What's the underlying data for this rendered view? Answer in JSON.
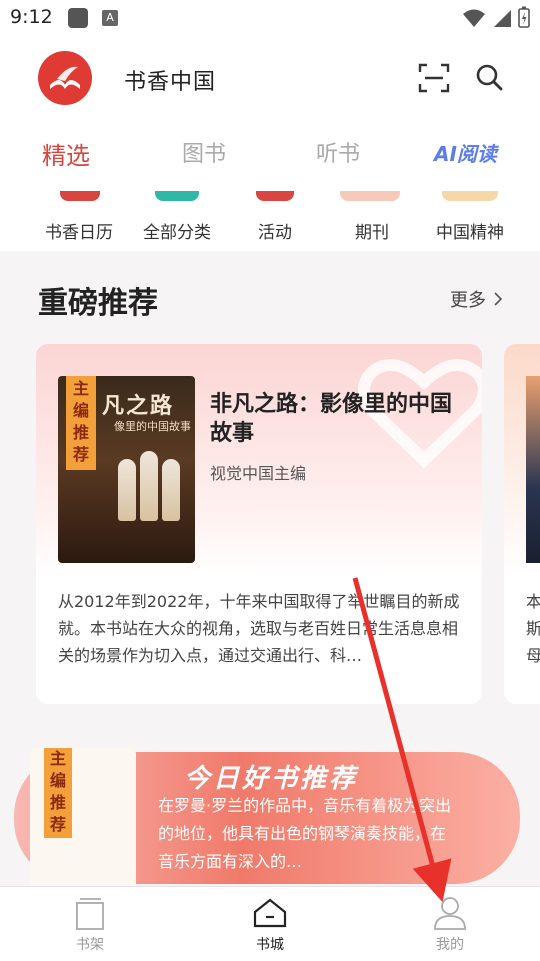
{
  "status_bar": {
    "time": "9:12",
    "a_label": "A"
  },
  "header": {
    "app_title": "书香中国"
  },
  "tabs": [
    {
      "label": "精选",
      "active": true
    },
    {
      "label": "图书",
      "active": false
    },
    {
      "label": "听书",
      "active": false
    },
    {
      "label": "AI阅读",
      "active": false
    }
  ],
  "categories": [
    "书香日历",
    "全部分类",
    "活动",
    "期刊",
    "中国精神"
  ],
  "section": {
    "title": "重磅推荐",
    "more_label": "更多"
  },
  "featured_book": {
    "title": "非凡之路：影像里的中国故事",
    "author": "视觉中国主编",
    "tag": "主编推荐",
    "cover_title": "凡之路",
    "cover_subtitle": "像里的中国故事",
    "description": "从2012年到2022年，十年来中国取得了举世瞩目的新成就。本书站在大众的视角，选取与老百姓日常生活息息相关的场景作为切入点，通过交通出行、科…"
  },
  "next_card_text": [
    "本",
    "斯",
    "母"
  ],
  "daily_banner": {
    "title": "今日好书推荐",
    "tag": "主编推荐",
    "text": "在罗曼·罗兰的作品中，音乐有着极为突出的地位，他具有出色的钢琴演奏技能，在音乐方面有深入的…"
  },
  "bottom_nav": [
    {
      "label": "书架",
      "active": false
    },
    {
      "label": "书城",
      "active": true
    },
    {
      "label": "我的",
      "active": false
    }
  ],
  "colors": {
    "accent": "#d9463f",
    "annotation": "#e8312b",
    "tag": "#f4a03a"
  }
}
